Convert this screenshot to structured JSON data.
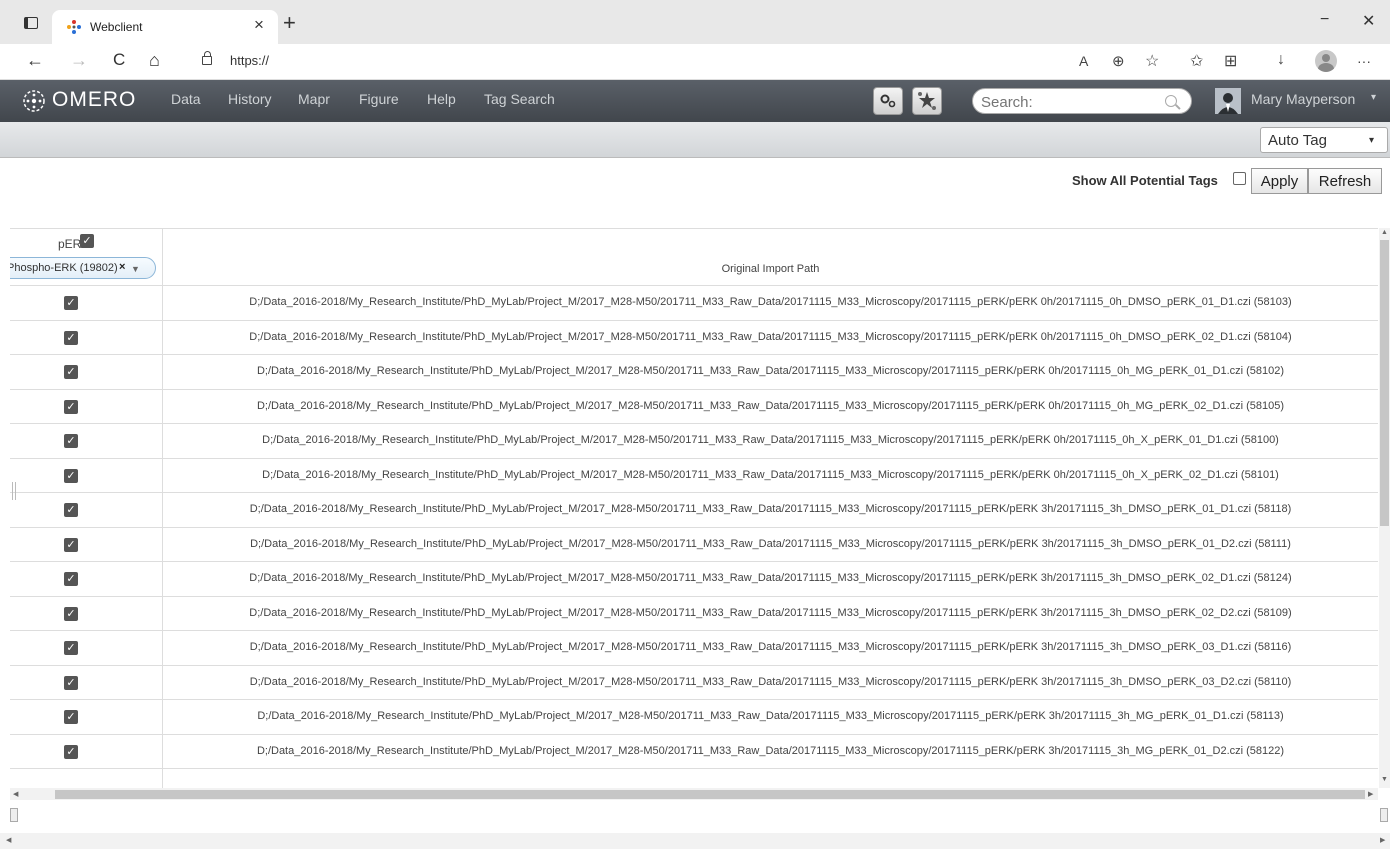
{
  "browser": {
    "tab_title": "Webclient",
    "tab_close": "×",
    "new_tab": "+",
    "url": "https://",
    "win_min": "−",
    "win_max": "▢",
    "win_close": "✕",
    "back": "←",
    "forward": "→",
    "reload": "C",
    "home": "⌂",
    "read_aloud": "A",
    "zoom": "⊕",
    "favorite": "☆",
    "favorites": "✩",
    "collections": "⊞",
    "downloads": "↓",
    "more": "···"
  },
  "header": {
    "logo": "OMERO",
    "menu": [
      "Data",
      "History",
      "Mapr",
      "Figure",
      "Help",
      "Tag Search"
    ],
    "search_placeholder": "Search:",
    "user": "Mary Mayperson",
    "user_caret": "▾"
  },
  "toolbar": {
    "autotag": "Auto Tag",
    "caret": "▾"
  },
  "controls": {
    "show_all_label": "Show All Potential Tags",
    "apply": "Apply",
    "refresh": "Refresh"
  },
  "table": {
    "tag_column": "pERK",
    "tag_pill": "Phospho-ERK (19802)",
    "tag_pill_remove": "×",
    "tag_pill_caret": "▼",
    "check_mark": "✓",
    "path_header": "Original Import Path",
    "rows": [
      "D;/Data_2016-2018/My_Research_Institute/PhD_MyLab/Project_M/2017_M28-M50/201711_M33_Raw_Data/20171115_M33_Microscopy/20171115_pERK/pERK 0h/20171115_0h_DMSO_pERK_01_D1.czi (58103)",
      "D;/Data_2016-2018/My_Research_Institute/PhD_MyLab/Project_M/2017_M28-M50/201711_M33_Raw_Data/20171115_M33_Microscopy/20171115_pERK/pERK 0h/20171115_0h_DMSO_pERK_02_D1.czi (58104)",
      "D;/Data_2016-2018/My_Research_Institute/PhD_MyLab/Project_M/2017_M28-M50/201711_M33_Raw_Data/20171115_M33_Microscopy/20171115_pERK/pERK 0h/20171115_0h_MG_pERK_01_D1.czi (58102)",
      "D;/Data_2016-2018/My_Research_Institute/PhD_MyLab/Project_M/2017_M28-M50/201711_M33_Raw_Data/20171115_M33_Microscopy/20171115_pERK/pERK 0h/20171115_0h_MG_pERK_02_D1.czi (58105)",
      "D;/Data_2016-2018/My_Research_Institute/PhD_MyLab/Project_M/2017_M28-M50/201711_M33_Raw_Data/20171115_M33_Microscopy/20171115_pERK/pERK 0h/20171115_0h_X_pERK_01_D1.czi (58100)",
      "D;/Data_2016-2018/My_Research_Institute/PhD_MyLab/Project_M/2017_M28-M50/201711_M33_Raw_Data/20171115_M33_Microscopy/20171115_pERK/pERK 0h/20171115_0h_X_pERK_02_D1.czi (58101)",
      "D;/Data_2016-2018/My_Research_Institute/PhD_MyLab/Project_M/2017_M28-M50/201711_M33_Raw_Data/20171115_M33_Microscopy/20171115_pERK/pERK 3h/20171115_3h_DMSO_pERK_01_D1.czi (58118)",
      "D;/Data_2016-2018/My_Research_Institute/PhD_MyLab/Project_M/2017_M28-M50/201711_M33_Raw_Data/20171115_M33_Microscopy/20171115_pERK/pERK 3h/20171115_3h_DMSO_pERK_01_D2.czi (58111)",
      "D;/Data_2016-2018/My_Research_Institute/PhD_MyLab/Project_M/2017_M28-M50/201711_M33_Raw_Data/20171115_M33_Microscopy/20171115_pERK/pERK 3h/20171115_3h_DMSO_pERK_02_D1.czi (58124)",
      "D;/Data_2016-2018/My_Research_Institute/PhD_MyLab/Project_M/2017_M28-M50/201711_M33_Raw_Data/20171115_M33_Microscopy/20171115_pERK/pERK 3h/20171115_3h_DMSO_pERK_02_D2.czi (58109)",
      "D;/Data_2016-2018/My_Research_Institute/PhD_MyLab/Project_M/2017_M28-M50/201711_M33_Raw_Data/20171115_M33_Microscopy/20171115_pERK/pERK 3h/20171115_3h_DMSO_pERK_03_D1.czi (58116)",
      "D;/Data_2016-2018/My_Research_Institute/PhD_MyLab/Project_M/2017_M28-M50/201711_M33_Raw_Data/20171115_M33_Microscopy/20171115_pERK/pERK 3h/20171115_3h_DMSO_pERK_03_D2.czi (58110)",
      "D;/Data_2016-2018/My_Research_Institute/PhD_MyLab/Project_M/2017_M28-M50/201711_M33_Raw_Data/20171115_M33_Microscopy/20171115_pERK/pERK 3h/20171115_3h_MG_pERK_01_D1.czi (58113)",
      "D;/Data_2016-2018/My_Research_Institute/PhD_MyLab/Project_M/2017_M28-M50/201711_M33_Raw_Data/20171115_M33_Microscopy/20171115_pERK/pERK 3h/20171115_3h_MG_pERK_01_D2.czi (58122)"
    ]
  },
  "colors": {
    "header_bg": "#4a4f55",
    "accent": "#8cb6d8"
  }
}
